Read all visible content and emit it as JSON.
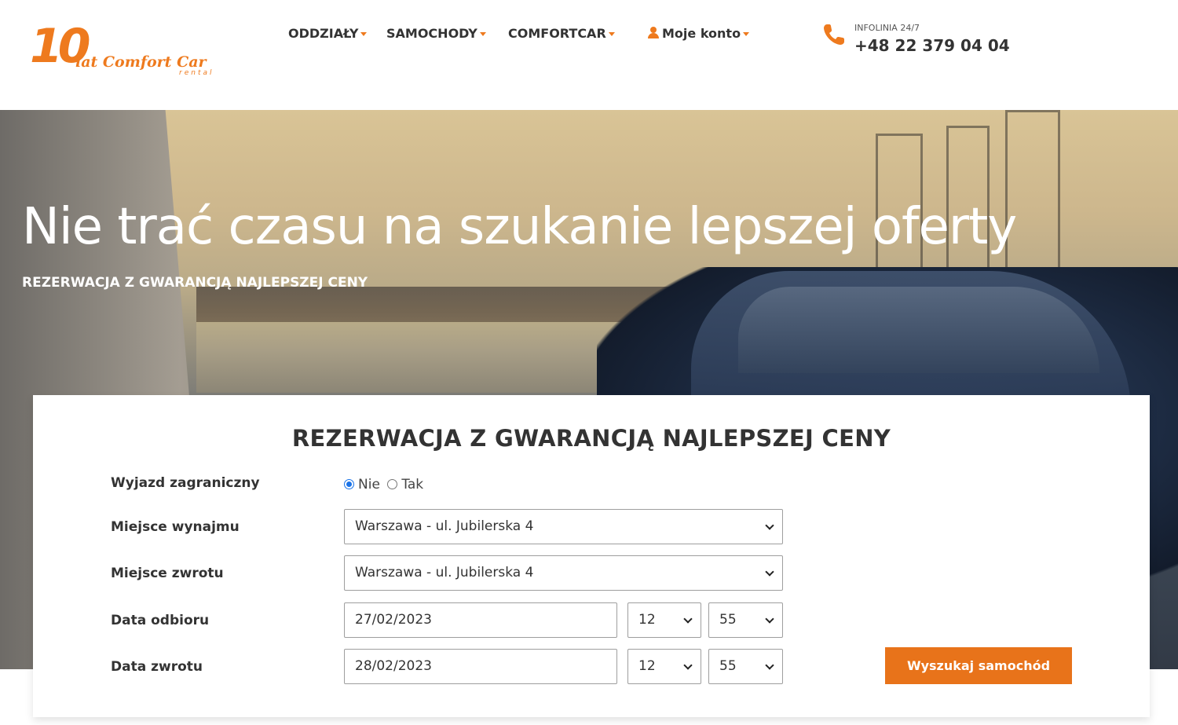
{
  "header": {
    "logo": {
      "number": "10",
      "brand": "lat Comfort Car",
      "tagline": "rental"
    },
    "nav": [
      {
        "label": "ODDZIAŁY"
      },
      {
        "label": "SAMOCHODY"
      },
      {
        "label": "COMFORTCAR"
      },
      {
        "label": "Moje konto"
      }
    ],
    "hotline": {
      "label": "INFOLINIA 24/7",
      "number": "+48 22 379 04 04"
    },
    "accent_color": "#ee7a1e"
  },
  "hero": {
    "title": "Nie trać czasu na szukanie lepszej oferty",
    "subtitle": "REZERWACJA Z GWARANCJĄ NAJLEPSZEJ CENY"
  },
  "booking": {
    "title": "REZERWACJA Z GWARANCJĄ NAJLEPSZEJ CENY",
    "abroad": {
      "label": "Wyjazd zagraniczny",
      "options": [
        {
          "label": "Nie",
          "checked": true
        },
        {
          "label": "Tak",
          "checked": false
        }
      ]
    },
    "pickup_place": {
      "label": "Miejsce wynajmu",
      "value": "Warszawa - ul. Jubilerska 4"
    },
    "return_place": {
      "label": "Miejsce zwrotu",
      "value": "Warszawa - ul. Jubilerska 4"
    },
    "pickup_date": {
      "label": "Data odbioru",
      "date": "27/02/2023",
      "hour": "12",
      "minute": "55"
    },
    "return_date": {
      "label": "Data zwrotu",
      "date": "28/02/2023",
      "hour": "12",
      "minute": "55"
    },
    "search_button": "Wyszukaj samochód",
    "button_color": "#e8731a"
  }
}
